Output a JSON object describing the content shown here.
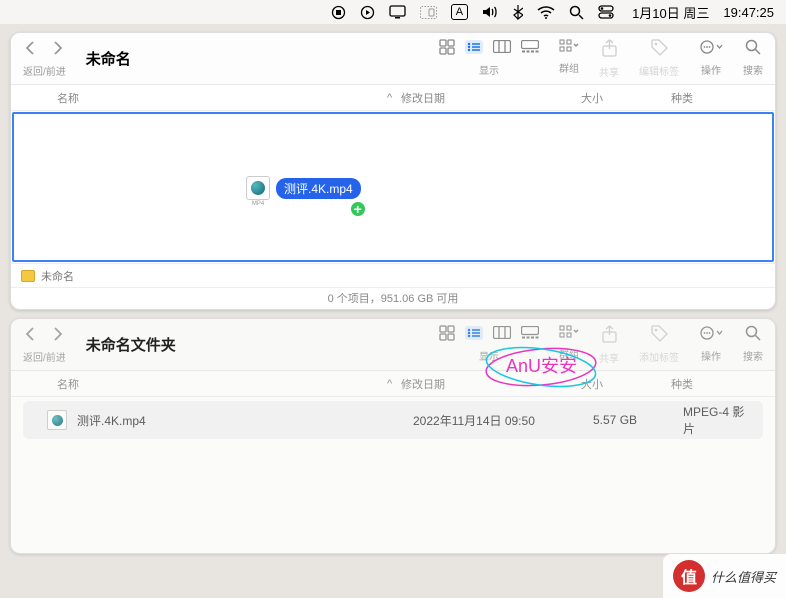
{
  "menubar": {
    "icons": [
      "stop",
      "play",
      "display",
      "app-switch",
      "input-A",
      "volume",
      "bluetooth",
      "wifi",
      "search",
      "control-center"
    ],
    "date": "1月10日 周三",
    "time": "19:47:25",
    "input_letter": "A"
  },
  "windowA": {
    "title": "未命名",
    "nav_label": "返回/前进",
    "toolbar": {
      "view_label": "显示",
      "group_label": "群组",
      "share_label": "共享",
      "tags_label": "编辑标签",
      "actions_label": "操作",
      "search_label": "搜索"
    },
    "columns": {
      "name": "名称",
      "date": "修改日期",
      "size": "大小",
      "kind": "种类"
    },
    "drag_file": "测评.4K.mp4",
    "path_label": "未命名",
    "status": "0 个项目，951.06 GB 可用"
  },
  "windowB": {
    "title": "未命名文件夹",
    "nav_label": "返回/前进",
    "toolbar": {
      "view_label": "显示",
      "group_label": "群组",
      "share_label": "共享",
      "tags_label": "添加标签",
      "actions_label": "操作",
      "search_label": "搜索"
    },
    "columns": {
      "name": "名称",
      "date": "修改日期",
      "size": "大小",
      "kind": "种类"
    },
    "rows": [
      {
        "name": "测评.4K.mp4",
        "date": "2022年11月14日 09:50",
        "size": "5.57 GB",
        "kind": "MPEG-4 影片"
      }
    ]
  },
  "watermark_text": "AnU安安",
  "corner_watermark": {
    "badge": "值",
    "text": "什么值得买"
  }
}
